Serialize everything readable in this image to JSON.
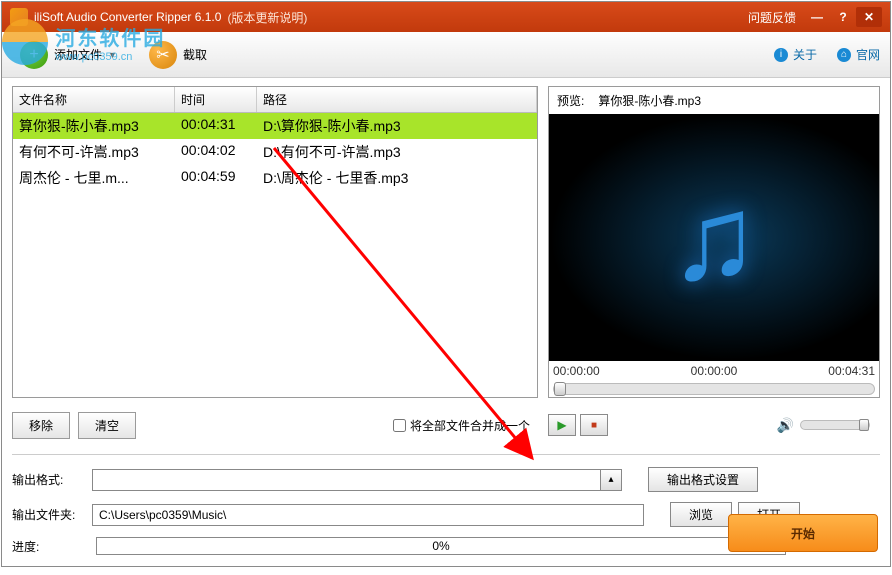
{
  "title": {
    "app": "iliSoft Audio Converter Ripper 6.1.0",
    "note": "(版本更新说明)",
    "feedback": "问题反馈"
  },
  "toolbar": {
    "add": "添加文件",
    "cut": "截取",
    "about": "关于",
    "website": "官网"
  },
  "table": {
    "headers": {
      "name": "文件名称",
      "time": "时间",
      "path": "路径"
    },
    "rows": [
      {
        "name": "算你狠-陈小春.mp3",
        "time": "00:04:31",
        "path": "D:\\算你狠-陈小春.mp3",
        "selected": true
      },
      {
        "name": "有何不可-许嵩.mp3",
        "time": "00:04:02",
        "path": "D:\\有何不可-许嵩.mp3",
        "selected": false
      },
      {
        "name": "周杰伦 - 七里.m...",
        "time": "00:04:59",
        "path": "D:\\周杰伦 - 七里香.mp3",
        "selected": false
      }
    ]
  },
  "preview": {
    "label": "预览:",
    "file": "算你狠-陈小春.mp3",
    "t0": "00:00:00",
    "t1": "00:00:00",
    "t2": "00:04:31"
  },
  "buttons": {
    "remove": "移除",
    "clear": "清空",
    "merge": "将全部文件合并成一个",
    "format_settings": "输出格式设置",
    "browse": "浏览",
    "open": "打开",
    "start": "开始"
  },
  "form": {
    "format_label": "输出格式:",
    "folder_label": "输出文件夹:",
    "folder_value": "C:\\Users\\pc0359\\Music\\",
    "progress_label": "进度:",
    "progress_value": "0%"
  },
  "watermark": {
    "name": "河东软件园",
    "url": "www.pc0359.cn"
  }
}
